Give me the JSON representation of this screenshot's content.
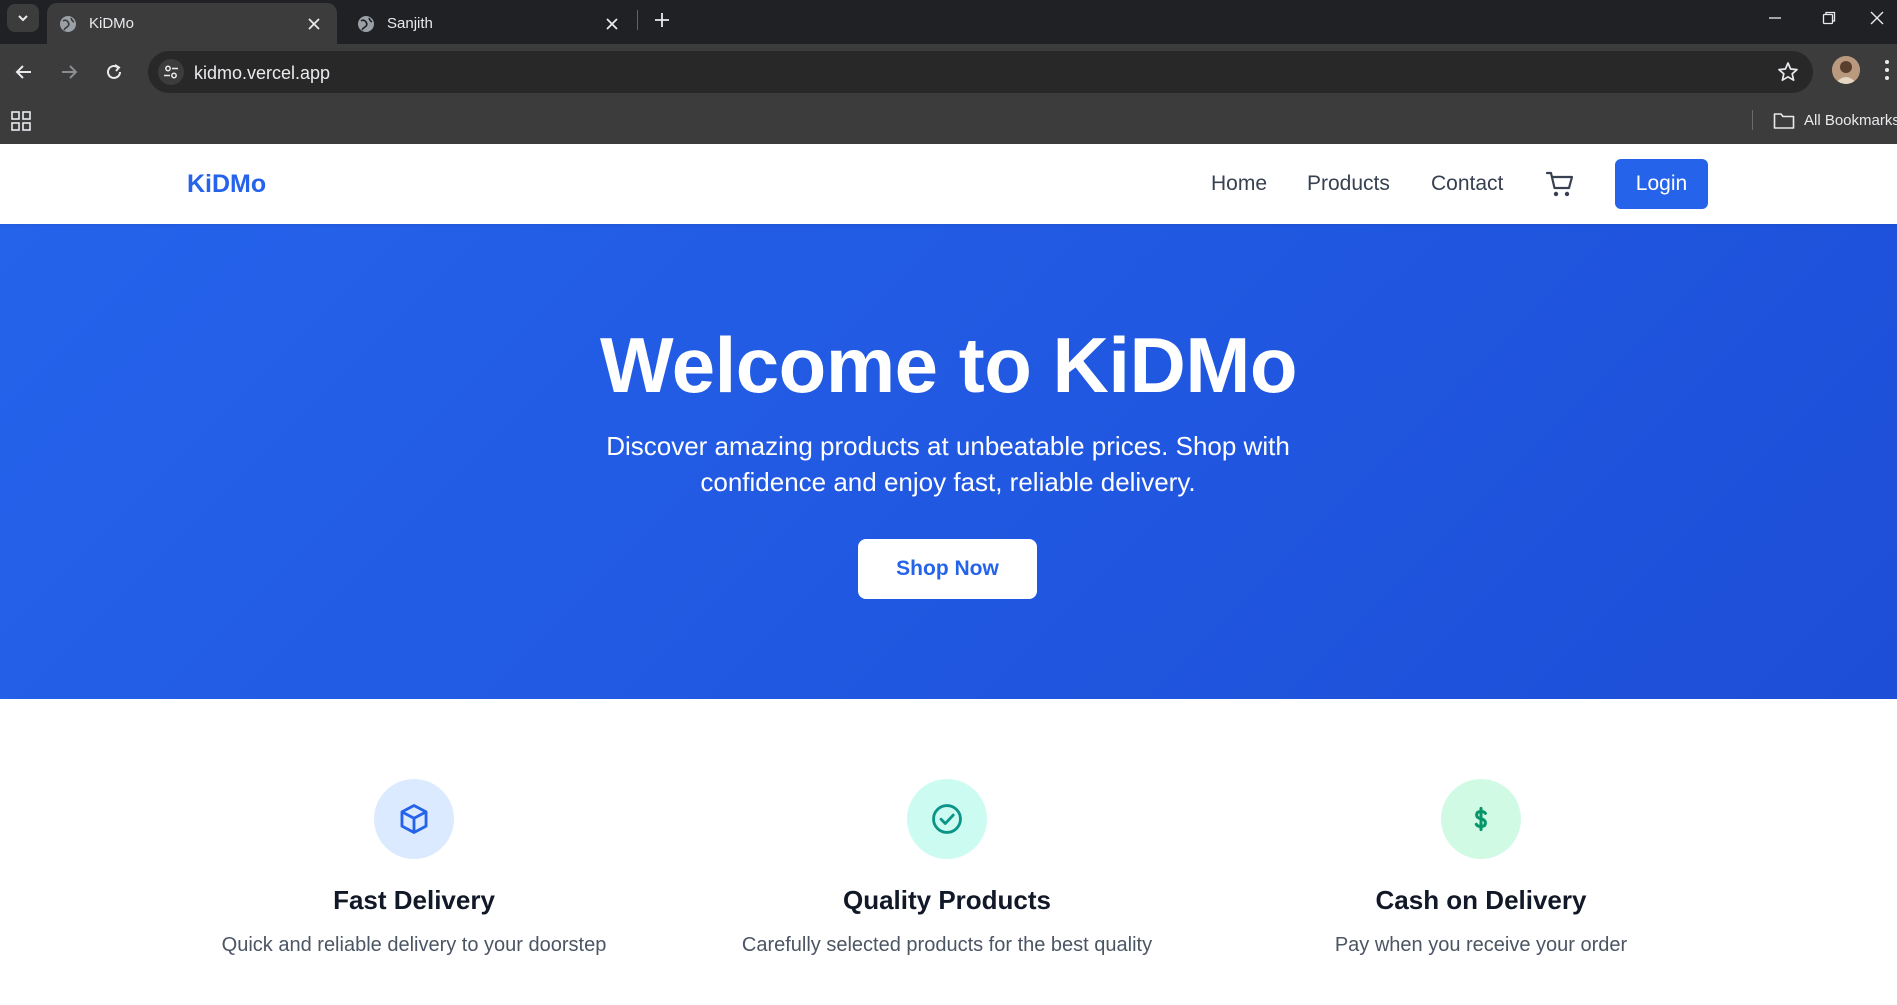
{
  "browser": {
    "tabs": [
      {
        "title": "KiDMo",
        "active": true
      },
      {
        "title": "Sanjith",
        "active": false
      }
    ],
    "url": "kidmo.vercel.app",
    "bookmarks_label": "All Bookmarks"
  },
  "site": {
    "logo": "KiDMo",
    "nav": {
      "home": "Home",
      "products": "Products",
      "contact": "Contact"
    },
    "login_label": "Login",
    "hero": {
      "title": "Welcome to KiDMo",
      "subtitle": "Discover amazing products at unbeatable prices. Shop with confidence and enjoy fast, reliable delivery.",
      "cta": "Shop Now"
    },
    "features": [
      {
        "title": "Fast Delivery",
        "desc": "Quick and reliable delivery to your doorstep",
        "icon": "box-icon",
        "icon_bg": "#dbeafe",
        "icon_color": "#2563eb"
      },
      {
        "title": "Quality Products",
        "desc": "Carefully selected products for the best quality",
        "icon": "check-circle-icon",
        "icon_bg": "#ccfbf1",
        "icon_color": "#0d9488"
      },
      {
        "title": "Cash on Delivery",
        "desc": "Pay when you receive your order",
        "icon": "dollar-icon",
        "icon_bg": "#d1fae5",
        "icon_color": "#059669"
      }
    ]
  },
  "colors": {
    "brand": "#2563eb",
    "chrome_dark": "#202124",
    "chrome_toolbar": "#3c3c3c"
  }
}
